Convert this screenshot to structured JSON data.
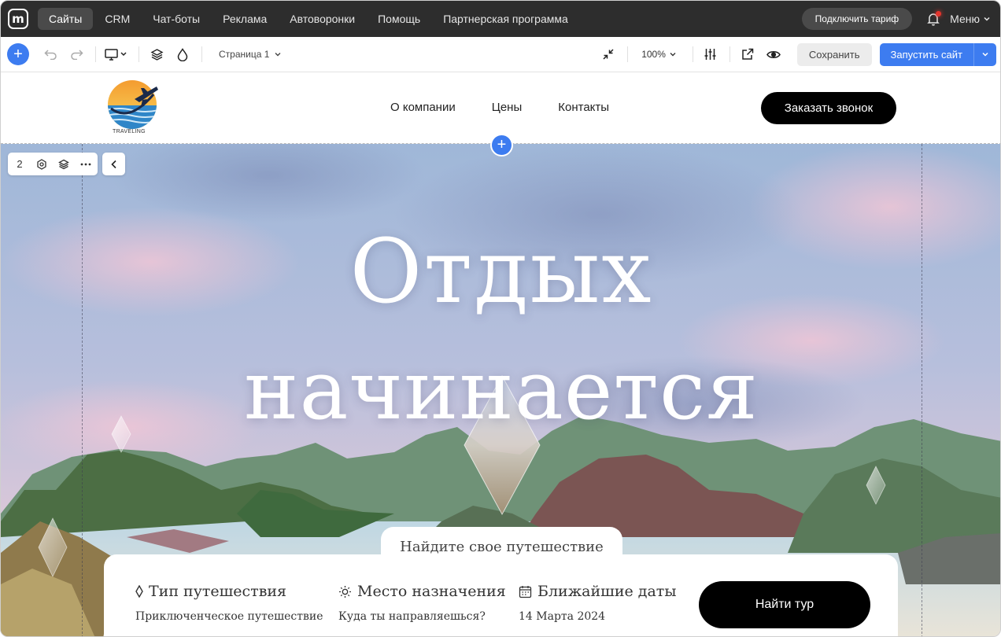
{
  "topnav": {
    "items": [
      {
        "label": "Сайты",
        "active": true
      },
      {
        "label": "CRM",
        "active": false
      },
      {
        "label": "Чат-боты",
        "active": false
      },
      {
        "label": "Реклама",
        "active": false
      },
      {
        "label": "Автоворонки",
        "active": false
      },
      {
        "label": "Помощь",
        "active": false
      },
      {
        "label": "Партнерская программа",
        "active": false
      }
    ],
    "tariff_label": "Подключить тариф",
    "menu_label": "Меню"
  },
  "toolbar": {
    "page_label": "Страница 1",
    "zoom_label": "100%",
    "save_label": "Сохранить",
    "launch_label": "Запустить сайт"
  },
  "site": {
    "brand_text": "TRAVELING",
    "nav": [
      "О компании",
      "Цены",
      "Контакты"
    ],
    "call_label": "Заказать звонок"
  },
  "block_tools": {
    "number": "2"
  },
  "hero": {
    "title_line1": "Отдых",
    "title_line2": "начинается"
  },
  "search": {
    "tab_label": "Найдите свое путешествие",
    "fields": [
      {
        "label": "Тип путешествия",
        "value": "Приключенческое путешествие",
        "icon": "diamond-icon"
      },
      {
        "label": "Место назначения",
        "value": "Куда ты направляешься?",
        "icon": "sun-icon"
      },
      {
        "label": "Ближайшие даты",
        "value": "14 Марта 2024",
        "icon": "calendar-icon"
      }
    ],
    "button_label": "Найти тур"
  },
  "colors": {
    "accent": "#3d7cf0",
    "topnav_bg": "#2d2d2d",
    "button_dark": "#000000"
  }
}
